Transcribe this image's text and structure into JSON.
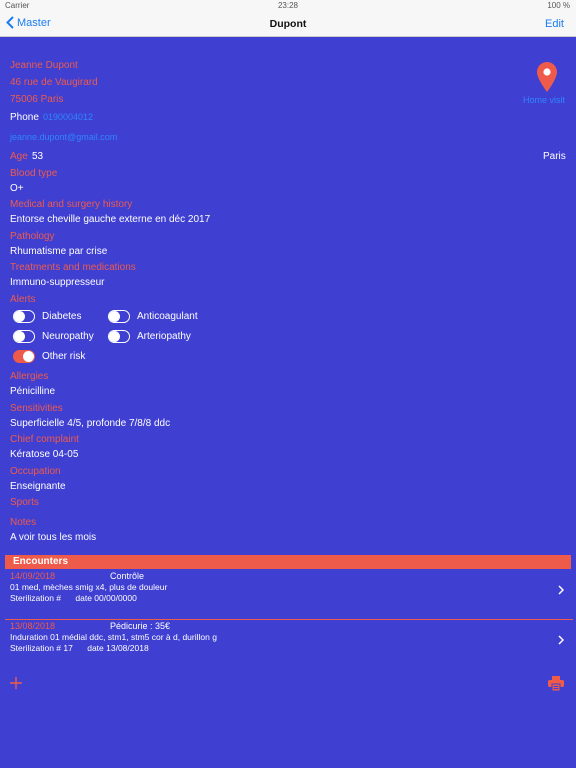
{
  "status": {
    "carrier": "Carrier",
    "time": "23:28",
    "battery": "100 %"
  },
  "nav": {
    "back": "Master",
    "title": "Dupont",
    "edit": "Edit"
  },
  "patient": {
    "name": "Jeanne  Dupont",
    "street": "46 rue de Vaugirard",
    "city": "75006  Paris",
    "phone_label": "Phone",
    "phone": "0190004012",
    "email": "jeanne.dupont@gmail.com",
    "home_visit": "Home visit",
    "age_label": "Age",
    "age": "53",
    "location": "Paris"
  },
  "fields": [
    {
      "label": "Blood type",
      "value": "O+"
    },
    {
      "label": "Medical and surgery history",
      "value": "Entorse cheville gauche externe en déc 2017"
    },
    {
      "label": "Pathology",
      "value": "Rhumatisme par crise"
    },
    {
      "label": "Treatments and medications",
      "value": "Immuno-suppresseur"
    }
  ],
  "alerts": {
    "label": "Alerts",
    "items": [
      {
        "label": "Diabetes",
        "on": false
      },
      {
        "label": "Anticoagulant",
        "on": false
      },
      {
        "label": "Neuropathy",
        "on": false
      },
      {
        "label": "Arteriopathy",
        "on": false
      },
      {
        "label": "Other risk",
        "on": true
      }
    ]
  },
  "fields2": [
    {
      "label": "Allergies",
      "value": "Pénicilline"
    },
    {
      "label": "Sensitivities",
      "value": "Superficielle 4/5, profonde 7/8/8 ddc"
    },
    {
      "label": "Chief complaint",
      "value": "Kératose 04-05"
    },
    {
      "label": "Occupation",
      "value": "Enseignante"
    },
    {
      "label": "Sports",
      "value": ""
    },
    {
      "label": "Notes",
      "value": "A voir tous les mois"
    }
  ],
  "encounters": {
    "header": "Encounters",
    "items": [
      {
        "date": "14/09/2018",
        "title": "Contrôle",
        "desc": "01 med, mèches smig x4, plus de douleur",
        "sterilization": "Sterilization #",
        "sdate": "date 00/00/0000"
      },
      {
        "date": "13/08/2018",
        "title": "Pédicurie : 35€",
        "desc": "Induration 01 médial ddc, stm1, stm5 cor à d, durillon g",
        "sterilization": "Sterilization # 17",
        "sdate": "date 13/08/2018"
      }
    ]
  },
  "colors": {
    "background": "#3f3fd2",
    "accent": "#ef5b4b",
    "link": "#2f86ff"
  }
}
